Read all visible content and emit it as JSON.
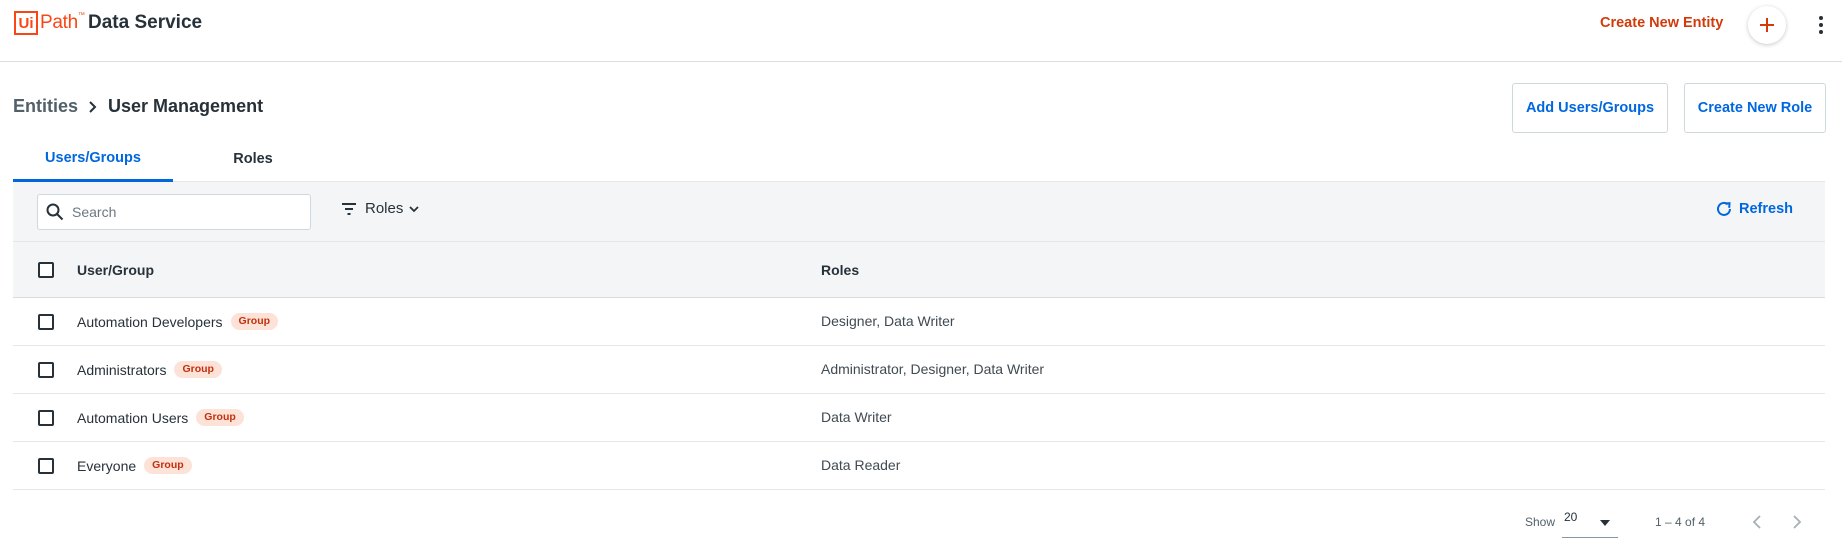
{
  "header": {
    "logo_box": "Ui",
    "logo_text": "Path",
    "logo_tm": "™",
    "app_title": "Data Service",
    "create_entity_label": "Create New Entity"
  },
  "breadcrumb": {
    "root": "Entities",
    "current": "User Management"
  },
  "actions": {
    "add_users_label": "Add Users/Groups",
    "create_role_label": "Create New Role"
  },
  "tabs": [
    {
      "label": "Users/Groups",
      "active": true
    },
    {
      "label": "Roles",
      "active": false
    }
  ],
  "toolbar": {
    "search_placeholder": "Search",
    "filter_label": "Roles",
    "refresh_label": "Refresh"
  },
  "table": {
    "columns": [
      "User/Group",
      "Roles"
    ],
    "rows": [
      {
        "name": "Automation Developers",
        "badge": "Group",
        "roles": "Designer, Data Writer"
      },
      {
        "name": "Administrators",
        "badge": "Group",
        "roles": "Administrator, Designer, Data Writer"
      },
      {
        "name": "Automation Users",
        "badge": "Group",
        "roles": "Data Writer"
      },
      {
        "name": "Everyone",
        "badge": "Group",
        "roles": "Data Reader"
      }
    ]
  },
  "pagination": {
    "show_label": "Show",
    "page_size": "20",
    "range": "1 – 4 of 4"
  },
  "colors": {
    "brand": "#fa4616",
    "accent": "#0067df",
    "badge_bg": "#fde2d8",
    "badge_text": "#c42f0d"
  }
}
